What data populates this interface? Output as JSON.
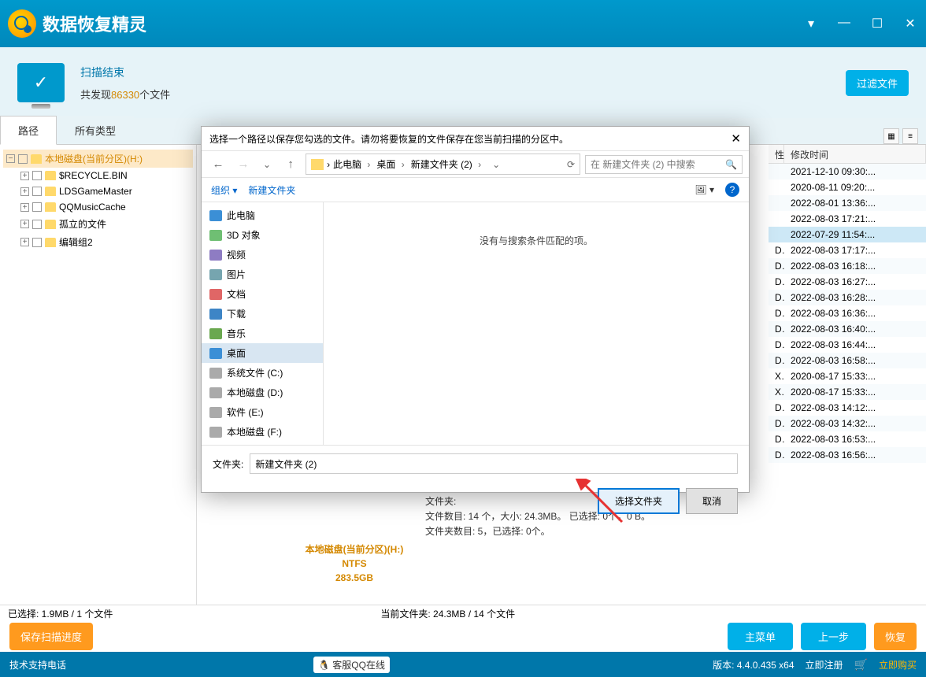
{
  "app_title": "数据恢复精灵",
  "titlebar": {
    "maximize": "☐",
    "minimize": "—",
    "dropdown": "▾",
    "close": "✕"
  },
  "scan": {
    "title": "扫描结束",
    "prefix": "共发现",
    "count": "86330",
    "suffix": "个文件",
    "filter_btn": "过滤文件"
  },
  "tabs": {
    "path": "路径",
    "types": "所有类型"
  },
  "tree": {
    "root": "本地磁盘(当前分区)(H:)",
    "children": [
      "$RECYCLE.BIN",
      "LDSGameMaster",
      "QQMusicCache",
      "孤立的文件",
      "编辑组2"
    ]
  },
  "table": {
    "col_attr": "性",
    "col_date": "修改时间",
    "rows": [
      {
        "a": "",
        "d": "2021-12-10 09:30:..."
      },
      {
        "a": "",
        "d": "2020-08-11 09:20:..."
      },
      {
        "a": "",
        "d": "2022-08-01 13:36:..."
      },
      {
        "a": "",
        "d": "2022-08-03 17:21:..."
      },
      {
        "a": "",
        "d": "2022-07-29 11:54:..."
      },
      {
        "a": "DX",
        "d": "2022-08-03 17:17:..."
      },
      {
        "a": "D",
        "d": "2022-08-03 16:18:..."
      },
      {
        "a": "DX",
        "d": "2022-08-03 16:27:..."
      },
      {
        "a": "DX",
        "d": "2022-08-03 16:28:..."
      },
      {
        "a": "DX",
        "d": "2022-08-03 16:36:..."
      },
      {
        "a": "D",
        "d": "2022-08-03 16:40:..."
      },
      {
        "a": "DX",
        "d": "2022-08-03 16:44:..."
      },
      {
        "a": "D",
        "d": "2022-08-03 16:58:..."
      },
      {
        "a": "X",
        "d": "2020-08-17 15:33:..."
      },
      {
        "a": "X",
        "d": "2020-08-17 15:33:..."
      },
      {
        "a": "D",
        "d": "2022-08-03 14:12:..."
      },
      {
        "a": "D",
        "d": "2022-08-03 14:32:..."
      },
      {
        "a": "D",
        "d": "2022-08-03 16:53:..."
      },
      {
        "a": "D",
        "d": "2022-08-03 16:56:..."
      }
    ]
  },
  "drive_box": {
    "line1": "本地磁盘(当前分区)(H:)",
    "line2": "NTFS",
    "line3": "283.5GB"
  },
  "summary": {
    "line0": "文件夹:",
    "line1": "文件数目: 14 个，大小: 24.3MB。 已选择: 0个，0 B。",
    "line2": "文件夹数目: 5，已选择: 0个。"
  },
  "status": {
    "selected": "已选择: 1.9MB / 1 个文件",
    "current": "当前文件夹:  24.3MB / 14 个文件"
  },
  "actions": {
    "save_progress": "保存扫描进度",
    "main_menu": "主菜单",
    "prev": "上一步",
    "recover": "恢复"
  },
  "footer": {
    "support": "技术支持电话",
    "qq": "客服QQ在线",
    "version": "版本:  4.4.0.435 x64",
    "register": "立即注册",
    "buy": "立即购买"
  },
  "dialog": {
    "title": "选择一个路径以保存您勾选的文件。请勿将要恢复的文件保存在您当前扫描的分区中。",
    "crumbs": [
      "此电脑",
      "桌面",
      "新建文件夹 (2)"
    ],
    "search_placeholder": "在 新建文件夹 (2) 中搜索",
    "toolbar_organize": "组织 ▾",
    "toolbar_new": "新建文件夹",
    "tree": [
      {
        "label": "此电脑",
        "icon": "icn-pc"
      },
      {
        "label": "3D 对象",
        "icon": "icn-3d"
      },
      {
        "label": "视频",
        "icon": "icn-vid"
      },
      {
        "label": "图片",
        "icon": "icn-img"
      },
      {
        "label": "文档",
        "icon": "icn-doc"
      },
      {
        "label": "下载",
        "icon": "icn-dl"
      },
      {
        "label": "音乐",
        "icon": "icn-mus"
      },
      {
        "label": "桌面",
        "icon": "icn-desk",
        "selected": true
      },
      {
        "label": "系统文件 (C:)",
        "icon": "icn-drive"
      },
      {
        "label": "本地磁盘 (D:)",
        "icon": "icn-drive"
      },
      {
        "label": "软件 (E:)",
        "icon": "icn-drive"
      },
      {
        "label": "本地磁盘 (F:)",
        "icon": "icn-drive"
      }
    ],
    "empty": "没有与搜索条件匹配的项。",
    "folder_label": "文件夹:",
    "folder_value": "新建文件夹 (2)",
    "select_btn": "选择文件夹",
    "cancel_btn": "取消"
  }
}
